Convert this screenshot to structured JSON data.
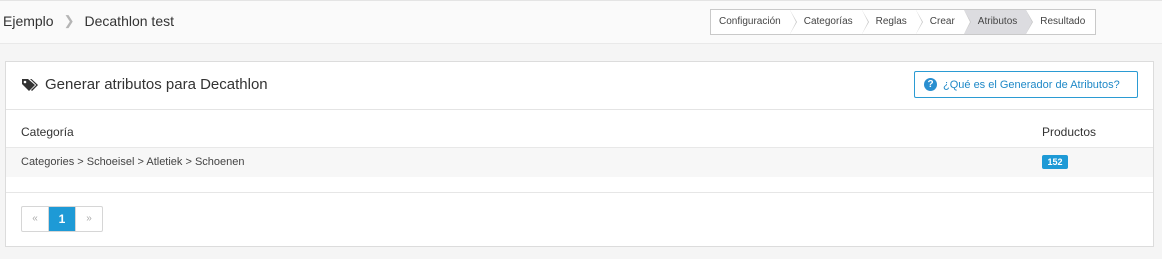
{
  "breadcrumb": {
    "parent": "Ejemplo",
    "current": "Decathlon test"
  },
  "steps": [
    "Configuración",
    "Categorías",
    "Reglas",
    "Crear",
    "Atributos",
    "Resultado"
  ],
  "active_step": "Atributos",
  "panel": {
    "title": "Generar atributos para Decathlon",
    "help_label": "¿Qué es el Generador de Atributos?",
    "icon": "tags-icon"
  },
  "table": {
    "headers": {
      "category": "Categoría",
      "products": "Productos"
    },
    "rows": [
      {
        "category": "Categories > Schoeisel > Atletiek > Schoenen",
        "products": "152"
      }
    ]
  },
  "pagination": {
    "prev": "«",
    "page": "1",
    "next": "»"
  },
  "colors": {
    "accent": "#1e9ad6",
    "active_step_bg": "#dcdce0"
  }
}
